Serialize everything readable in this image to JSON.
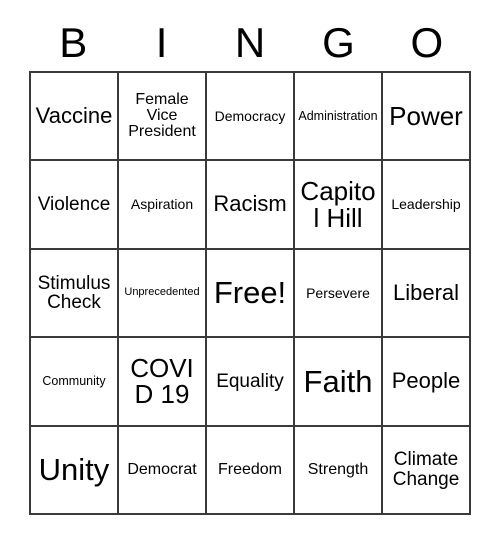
{
  "card": {
    "header": {
      "letters": [
        "B",
        "I",
        "N",
        "G",
        "O"
      ]
    },
    "columns": 5,
    "rows": 5,
    "free_space": "Free!",
    "cells": [
      {
        "text": "Vaccine",
        "size": "xl"
      },
      {
        "text": "Female Vice President",
        "size": "m"
      },
      {
        "text": "Democracy",
        "size": "s"
      },
      {
        "text": "Administration",
        "size": "xs"
      },
      {
        "text": "Power",
        "size": "xxl"
      },
      {
        "text": "Violence",
        "size": "l"
      },
      {
        "text": "Aspiration",
        "size": "s"
      },
      {
        "text": "Racism",
        "size": "xl"
      },
      {
        "text": "Capitol Hill",
        "size": "xxl"
      },
      {
        "text": "Leadership",
        "size": "s"
      },
      {
        "text": "Stimulus Check",
        "size": "l"
      },
      {
        "text": "Unprecedented",
        "size": "xxs"
      },
      {
        "text": "Free!",
        "size": "huge"
      },
      {
        "text": "Persevere",
        "size": "s"
      },
      {
        "text": "Liberal",
        "size": "xl"
      },
      {
        "text": "Community",
        "size": "xs"
      },
      {
        "text": "COVID 19",
        "size": "xxl"
      },
      {
        "text": "Equality",
        "size": "l"
      },
      {
        "text": "Faith",
        "size": "huge"
      },
      {
        "text": "People",
        "size": "xl"
      },
      {
        "text": "Unity",
        "size": "huge"
      },
      {
        "text": "Democrat",
        "size": "m"
      },
      {
        "text": "Freedom",
        "size": "m"
      },
      {
        "text": "Strength",
        "size": "m"
      },
      {
        "text": "Climate Change",
        "size": "l"
      }
    ],
    "colors": {
      "background": "#ffffff",
      "border": "#3a3a3a",
      "text": "#000000"
    }
  }
}
